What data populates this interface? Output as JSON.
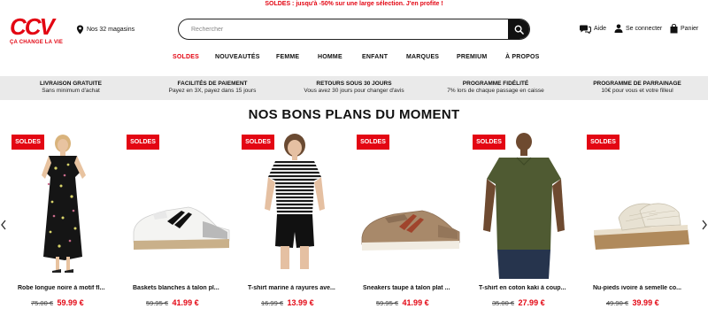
{
  "promo_bar": "SOLDES : jusqu'à -50% sur une large sélection. J'en profite !",
  "logo": {
    "mark": "CCV",
    "tagline": "ÇA CHANGE LA VIE"
  },
  "stores": {
    "label": "Nos 32 magasins",
    "icon": "map-pin-icon"
  },
  "search": {
    "placeholder": "Rechercher",
    "value": "",
    "icon": "search-icon"
  },
  "utilities": [
    {
      "label": "Aide",
      "icon": "chat-icon"
    },
    {
      "label": "Se connecter",
      "icon": "user-icon"
    },
    {
      "label": "Panier",
      "icon": "bag-icon"
    }
  ],
  "nav": [
    {
      "label": "SOLDES",
      "active": true
    },
    {
      "label": "NOUVEAUTÉS",
      "active": false
    },
    {
      "label": "FEMME",
      "active": false
    },
    {
      "label": "HOMME",
      "active": false
    },
    {
      "label": "ENFANT",
      "active": false
    },
    {
      "label": "MARQUES",
      "active": false
    },
    {
      "label": "PREMIUM",
      "active": false
    },
    {
      "label": "À PROPOS",
      "active": false
    }
  ],
  "benefits": [
    {
      "title": "LIVRAISON GRATUITE",
      "sub": "Sans minimum d'achat"
    },
    {
      "title": "FACILITÉS DE PAIEMENT",
      "sub": "Payez en 3X, payez dans 15 jours"
    },
    {
      "title": "RETOURS SOUS 30 JOURS",
      "sub": "Vous avez 30 jours pour changer d'avis"
    },
    {
      "title": "PROGRAMME FIDÉLITÉ",
      "sub": "7% lors de chaque passage en caisse"
    },
    {
      "title": "PROGRAMME DE PARRAINAGE",
      "sub": "10€ pour vous et votre filleul"
    }
  ],
  "section_title": "NOS BONS PLANS DU MOMENT",
  "badge_label": "SOLDES",
  "products": [
    {
      "name": "Robe longue noire à motif fl...",
      "old_price": "75.00 €",
      "new_price": "59.99 €",
      "image": "floral-dress"
    },
    {
      "name": "Baskets blanches à talon pl...",
      "old_price": "59.95 €",
      "new_price": "41.99 €",
      "image": "white-sneaker"
    },
    {
      "name": "T-shirt marine à rayures ave...",
      "old_price": "16.99 €",
      "new_price": "13.99 €",
      "image": "striped-tshirt"
    },
    {
      "name": "Sneakers taupe à talon plat ...",
      "old_price": "59.95 €",
      "new_price": "41.99 €",
      "image": "taupe-sneaker"
    },
    {
      "name": "T-shirt en coton kaki à coup...",
      "old_price": "35.00 €",
      "new_price": "27.99 €",
      "image": "khaki-tshirt"
    },
    {
      "name": "Nu-pieds ivoire à semelle co...",
      "old_price": "49.90 €",
      "new_price": "39.99 €",
      "image": "ivory-sandal"
    }
  ],
  "colors": {
    "brand": "#e30613",
    "band": "#eaeaea"
  }
}
